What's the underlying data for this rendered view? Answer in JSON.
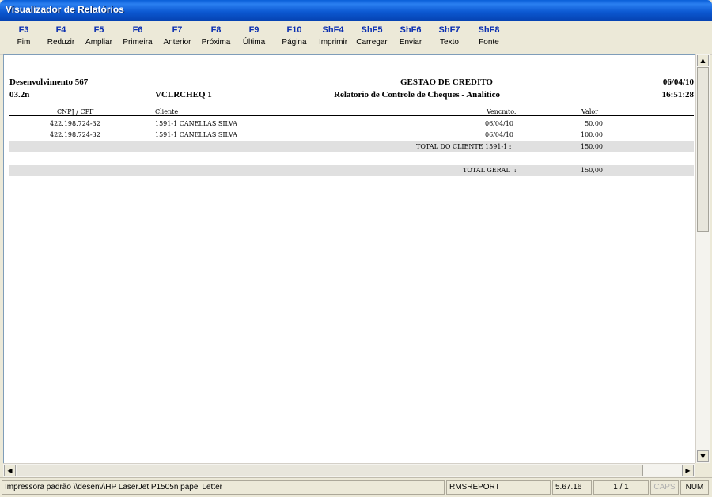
{
  "window": {
    "title": "Visualizador de Relatórios"
  },
  "toolbar": [
    {
      "key": "F3",
      "label": "Fim"
    },
    {
      "key": "F4",
      "label": "Reduzir"
    },
    {
      "key": "F5",
      "label": "Ampliar"
    },
    {
      "key": "F6",
      "label": "Primeira"
    },
    {
      "key": "F7",
      "label": "Anterior"
    },
    {
      "key": "F8",
      "label": "Próxima"
    },
    {
      "key": "F9",
      "label": "Última"
    },
    {
      "key": "F10",
      "label": "Página"
    },
    {
      "key": "ShF4",
      "label": "Imprimir"
    },
    {
      "key": "ShF5",
      "label": "Carregar"
    },
    {
      "key": "ShF6",
      "label": "Enviar"
    },
    {
      "key": "ShF7",
      "label": "Texto"
    },
    {
      "key": "ShF8",
      "label": "Fonte"
    }
  ],
  "report": {
    "company": "Desenvolvimento 567",
    "code": "03.2n",
    "program": "VCLRCHEQ 1",
    "system": "GESTAO DE CREDITO",
    "title": "Relatorio de Controle de Cheques - Analitico",
    "date": "06/04/10",
    "time": "16:51:28",
    "columns": {
      "cnpj": "CNPJ / CPF",
      "cliente": "Cliente",
      "vencimento": "Vencmto.",
      "valor": "Valor"
    },
    "rows": [
      {
        "cnpj": "422.198.724-32",
        "cliente": "1591-1 CANELLAS SILVA",
        "vencimento": "06/04/10",
        "valor": "50,00"
      },
      {
        "cnpj": "422.198.724-32",
        "cliente": "1591-1 CANELLAS SILVA",
        "vencimento": "06/04/10",
        "valor": "100,00"
      }
    ],
    "total_cliente_label": "TOTAL DO CLIENTE 1591-1 :",
    "total_cliente_value": "150,00",
    "total_geral_label": "TOTAL GERAL  :",
    "total_geral_value": "150,00"
  },
  "status": {
    "printer": "Impressora padrão \\\\desenv\\HP LaserJet P1505n papel Letter",
    "app": "RMSREPORT",
    "version": "5.67.16",
    "page": "1 / 1",
    "caps": "CAPS",
    "num": "NUM"
  }
}
